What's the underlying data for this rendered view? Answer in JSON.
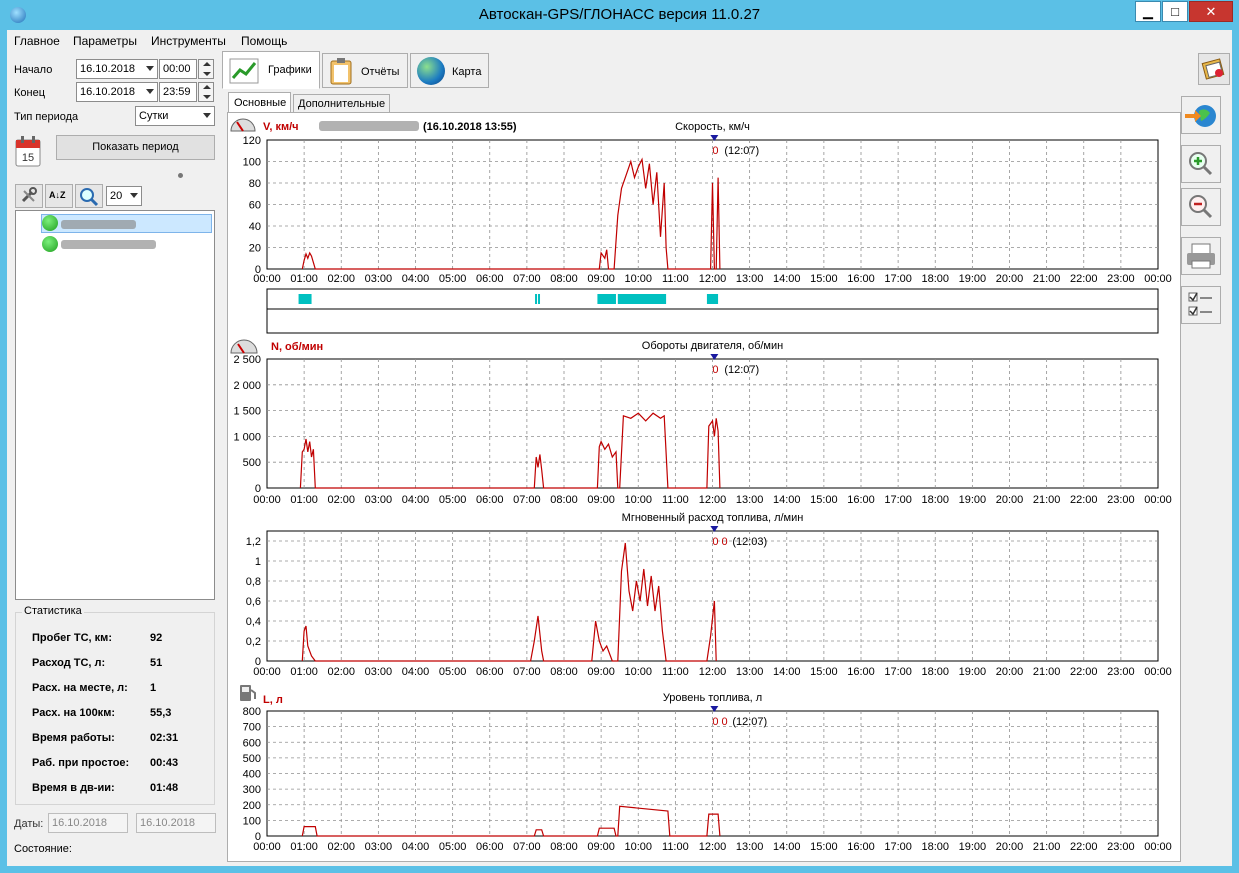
{
  "window": {
    "title": "Автоскан-GPS/ГЛОНАСС версия 11.0.27",
    "minimize": "▁",
    "maximize": "□",
    "close": "✕"
  },
  "menu": [
    "Главное",
    "Параметры",
    "Инструменты",
    "Помощь"
  ],
  "period": {
    "start_label": "Начало",
    "start_date": "16.10.2018",
    "start_time": "00:00",
    "end_label": "Конец",
    "end_date": "16.10.2018",
    "end_time": "23:59",
    "type_label": "Тип периода",
    "type_value": "Сутки",
    "show_button": "Показать период",
    "calendar_day": "15"
  },
  "toolbar": {
    "zoom_value": "20",
    "sort_label": "A↓Z"
  },
  "statistics": {
    "title": "Статистика",
    "rows": [
      {
        "label": "Пробег ТС, км:",
        "value": "92"
      },
      {
        "label": "Расход ТС, л:",
        "value": "51"
      },
      {
        "label": "Расх. на месте, л:",
        "value": "1"
      },
      {
        "label": "Расх. на 100км:",
        "value": "55,3"
      },
      {
        "label": "Время работы:",
        "value": "02:31"
      },
      {
        "label": "Раб. при простое:",
        "value": "00:43"
      },
      {
        "label": "Время в дв-ии:",
        "value": "01:48"
      }
    ]
  },
  "dates": {
    "label": "Даты:",
    "from": "16.10.2018",
    "to": "16.10.2018"
  },
  "status": {
    "label": "Состояние:"
  },
  "main_tabs": [
    {
      "label": "Графики",
      "icon": "chart-icon"
    },
    {
      "label": "Отчёты",
      "icon": "clipboard-icon"
    },
    {
      "label": "Карта",
      "icon": "globe-icon"
    }
  ],
  "sub_tabs": [
    "Основные",
    "Дополнительные"
  ],
  "header_date": "(16.10.2018 13:55)",
  "x_ticks": [
    "00:00",
    "01:00",
    "02:00",
    "03:00",
    "04:00",
    "05:00",
    "06:00",
    "07:00",
    "08:00",
    "09:00",
    "10:00",
    "11:00",
    "12:00",
    "13:00",
    "14:00",
    "15:00",
    "16:00",
    "17:00",
    "18:00",
    "19:00",
    "20:00",
    "21:00",
    "22:00",
    "23:00",
    "00:00"
  ],
  "colors": {
    "series": "#c00000",
    "segments": "#00c0c0",
    "cursor": "#1a1aa0",
    "grid": "#909090"
  },
  "chart_data": [
    {
      "type": "line",
      "title": "Скорость, км/ч",
      "ylabel": "V, км/ч",
      "ylim": [
        0,
        120
      ],
      "y_ticks": [
        "0",
        "20",
        "40",
        "60",
        "80",
        "100",
        "120"
      ],
      "cursor_label": "0",
      "cursor_time": "(12:07)",
      "cursor_x": 12.05,
      "x": [
        0.95,
        1.0,
        1.05,
        1.1,
        1.15,
        1.2,
        1.25,
        1.3,
        8.95,
        9.0,
        9.1,
        9.15,
        9.2,
        9.35,
        9.45,
        9.55,
        9.7,
        9.8,
        9.9,
        10.0,
        10.1,
        10.2,
        10.3,
        10.4,
        10.5,
        10.6,
        10.7,
        10.75,
        10.8,
        11.95,
        12.0,
        12.05,
        12.1,
        12.15,
        12.2
      ],
      "y": [
        0,
        8,
        14,
        10,
        15,
        12,
        6,
        0,
        0,
        15,
        10,
        18,
        0,
        0,
        50,
        75,
        90,
        100,
        85,
        95,
        102,
        75,
        98,
        60,
        90,
        30,
        80,
        20,
        0,
        0,
        80,
        0,
        0,
        85,
        0
      ]
    },
    {
      "type": "line",
      "title": "Обороты двигателя, об/мин",
      "ylabel": "N, об/мин",
      "ylim": [
        0,
        2500
      ],
      "y_ticks": [
        "0",
        "500",
        "1 000",
        "1 500",
        "2 000",
        "2 500"
      ],
      "cursor_label": "0",
      "cursor_time": "(12:07)",
      "cursor_x": 12.05,
      "x": [
        0.9,
        0.95,
        1.0,
        1.05,
        1.1,
        1.15,
        1.2,
        1.25,
        1.3,
        7.2,
        7.25,
        7.3,
        7.35,
        7.4,
        7.45,
        8.9,
        8.95,
        9.0,
        9.1,
        9.2,
        9.3,
        9.4,
        9.45,
        9.5,
        9.6,
        9.8,
        10.0,
        10.2,
        10.4,
        10.6,
        10.7,
        10.8,
        11.85,
        11.9,
        12.0,
        12.05,
        12.1,
        12.15,
        12.2
      ],
      "y": [
        0,
        700,
        750,
        950,
        700,
        900,
        600,
        750,
        0,
        0,
        600,
        400,
        650,
        350,
        0,
        0,
        800,
        900,
        750,
        850,
        600,
        700,
        0,
        0,
        1400,
        1350,
        1450,
        1300,
        1450,
        1350,
        1400,
        0,
        0,
        1200,
        1300,
        1000,
        1350,
        1100,
        0
      ]
    },
    {
      "type": "line",
      "title": "Мгновенный расход топлива, л/мин",
      "ylabel": "",
      "ylim": [
        0,
        1.3
      ],
      "y_ticks": [
        "0",
        "0,2",
        "0,4",
        "0,6",
        "0,8",
        "1",
        "1,2"
      ],
      "cursor_label": "0 0",
      "cursor_time": "(12:03)",
      "cursor_x": 12.05,
      "x": [
        0.95,
        1.0,
        1.05,
        1.1,
        1.2,
        1.3,
        7.1,
        7.2,
        7.3,
        7.4,
        7.45,
        8.75,
        8.85,
        8.95,
        9.05,
        9.15,
        9.3,
        9.45,
        9.55,
        9.65,
        9.75,
        9.85,
        9.95,
        10.05,
        10.15,
        10.25,
        10.35,
        10.45,
        10.55,
        10.65,
        10.75,
        11.85,
        11.95,
        12.05,
        12.1
      ],
      "y": [
        0,
        0.3,
        0.35,
        0.15,
        0.05,
        0,
        0,
        0.2,
        0.45,
        0.1,
        0,
        0,
        0.4,
        0.2,
        0.1,
        0.15,
        0,
        0,
        0.9,
        1.18,
        0.7,
        0.5,
        0.8,
        0.6,
        0.92,
        0.55,
        0.85,
        0.5,
        0.75,
        0.3,
        0,
        0,
        0.25,
        0.6,
        0
      ]
    },
    {
      "type": "line",
      "title": "Уровень топлива, л",
      "ylabel": "L, л",
      "ylim": [
        0,
        800
      ],
      "y_ticks": [
        "0",
        "100",
        "200",
        "300",
        "400",
        "500",
        "600",
        "700",
        "800"
      ],
      "cursor_label": "0 0",
      "cursor_time": "(12:07)",
      "cursor_x": 12.05,
      "x": [
        0.95,
        1.0,
        1.3,
        1.35,
        7.2,
        7.25,
        7.4,
        7.45,
        8.9,
        8.95,
        9.35,
        9.4,
        9.45,
        9.5,
        10.8,
        10.85,
        11.85,
        11.9,
        12.15,
        12.2
      ],
      "y": [
        0,
        60,
        60,
        0,
        0,
        40,
        40,
        0,
        0,
        50,
        50,
        0,
        0,
        190,
        160,
        0,
        0,
        140,
        140,
        0
      ]
    }
  ],
  "segments": {
    "rows": [
      {
        "start": 0.85,
        "end": 1.2
      },
      {
        "start": 7.22,
        "end": 7.26
      },
      {
        "start": 7.3,
        "end": 7.35
      },
      {
        "start": 8.9,
        "end": 9.4
      },
      {
        "start": 9.45,
        "end": 10.75
      },
      {
        "start": 11.85,
        "end": 12.15
      }
    ]
  }
}
